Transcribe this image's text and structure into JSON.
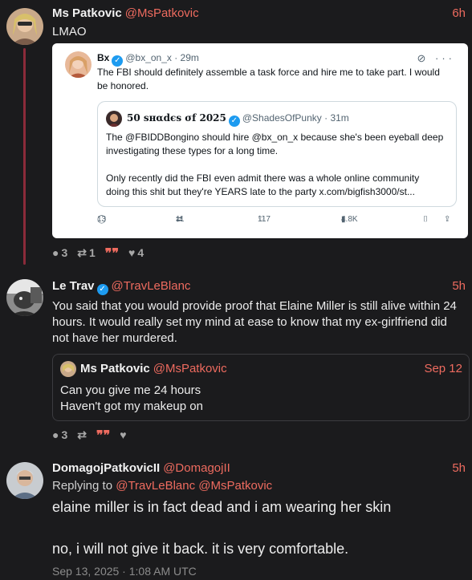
{
  "post1": {
    "name": "Ms Patkovic",
    "handle": "@MsPatkovic",
    "time": "6h",
    "text": "LMAO",
    "embed": {
      "name": "Bx",
      "handle_time": "@bx_on_x · 29m",
      "text": "The FBI should definitely assemble a task force and hire me to take part. I would be honored.",
      "quoted": {
        "name": "50 sнαdєs σf 2025",
        "handle_time": "@ShadesOfPunky · 31m",
        "text1": "The @FBIDDBongino should hire @bx_on_x because she's been eyeball deep investigating these types for a long time.",
        "text2": "Only recently did the FBI even admit there was a whole online community doing this shit but they're YEARS late to the party x.com/bigfish3000/st..."
      },
      "metrics": {
        "replies": "13",
        "reposts": "11",
        "likes": "117",
        "views": "4.8K"
      }
    },
    "actions": {
      "replies": "3",
      "reposts": "1",
      "likes": "4"
    }
  },
  "post2": {
    "name": "Le Trav",
    "handle": "@TravLeBlanc",
    "time": "5h",
    "text": "You said that you would provide proof that Elaine Miller is still alive within 24 hours. It would really set my mind at ease to know that my ex-girlfriend did not have her murdered.",
    "quote": {
      "name": "Ms Patkovic",
      "handle": "@MsPatkovic",
      "date": "Sep 12",
      "line1": "Can you give me 24 hours",
      "line2": "Haven't got my makeup on"
    },
    "actions": {
      "replies": "3"
    }
  },
  "post3": {
    "name": "DomagojPatkovicII",
    "handle": "@DomagojII",
    "time": "5h",
    "replying_prefix": "Replying to",
    "replying_to": "@TravLeBlanc @MsPatkovic",
    "line1": "elaine miller is in fact dead and i am wearing her skin",
    "line2": "no, i will not give it back. it is very comfortable.",
    "timestamp": "Sep 13, 2025 · 1:08 AM UTC"
  },
  "icons": {
    "reply": "speech-bubble",
    "repost": "retweet-arrows",
    "quote": "quote-marks",
    "like": "heart",
    "verified": "blue-check"
  },
  "colors": {
    "accent": "#ee6b5f",
    "thread": "#8b2b3a",
    "background": "#1b1b1d",
    "verified": "#1d9bf0"
  }
}
